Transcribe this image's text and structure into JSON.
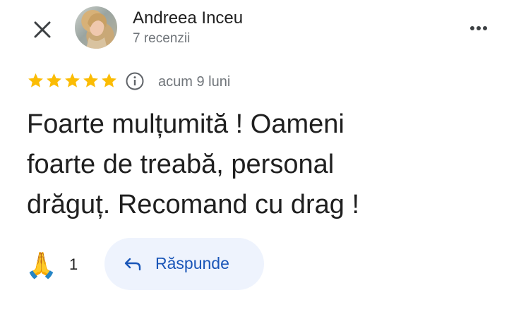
{
  "header": {
    "close_icon": "close-icon",
    "avatar": "user-avatar-photo",
    "author_name": "Andreea Inceu",
    "author_reviews": "7 recenzii",
    "more_icon": "more-horizontal-icon"
  },
  "rating": {
    "stars": 5,
    "max_stars": 5,
    "star_color": "#fbbc04",
    "info_icon": "info-icon",
    "time": "acum 9 luni"
  },
  "review": {
    "lines": [
      "Foarte mulțumită ! Oameni",
      "foarte de treabă, personal",
      "drăguț. Recomand cu drag !"
    ]
  },
  "actions": {
    "reaction_emoji": "🙏",
    "reaction_count": "1",
    "reply_icon": "reply-arrow-icon",
    "reply_label": "Răspunde",
    "reply_color": "#1a56b8"
  }
}
